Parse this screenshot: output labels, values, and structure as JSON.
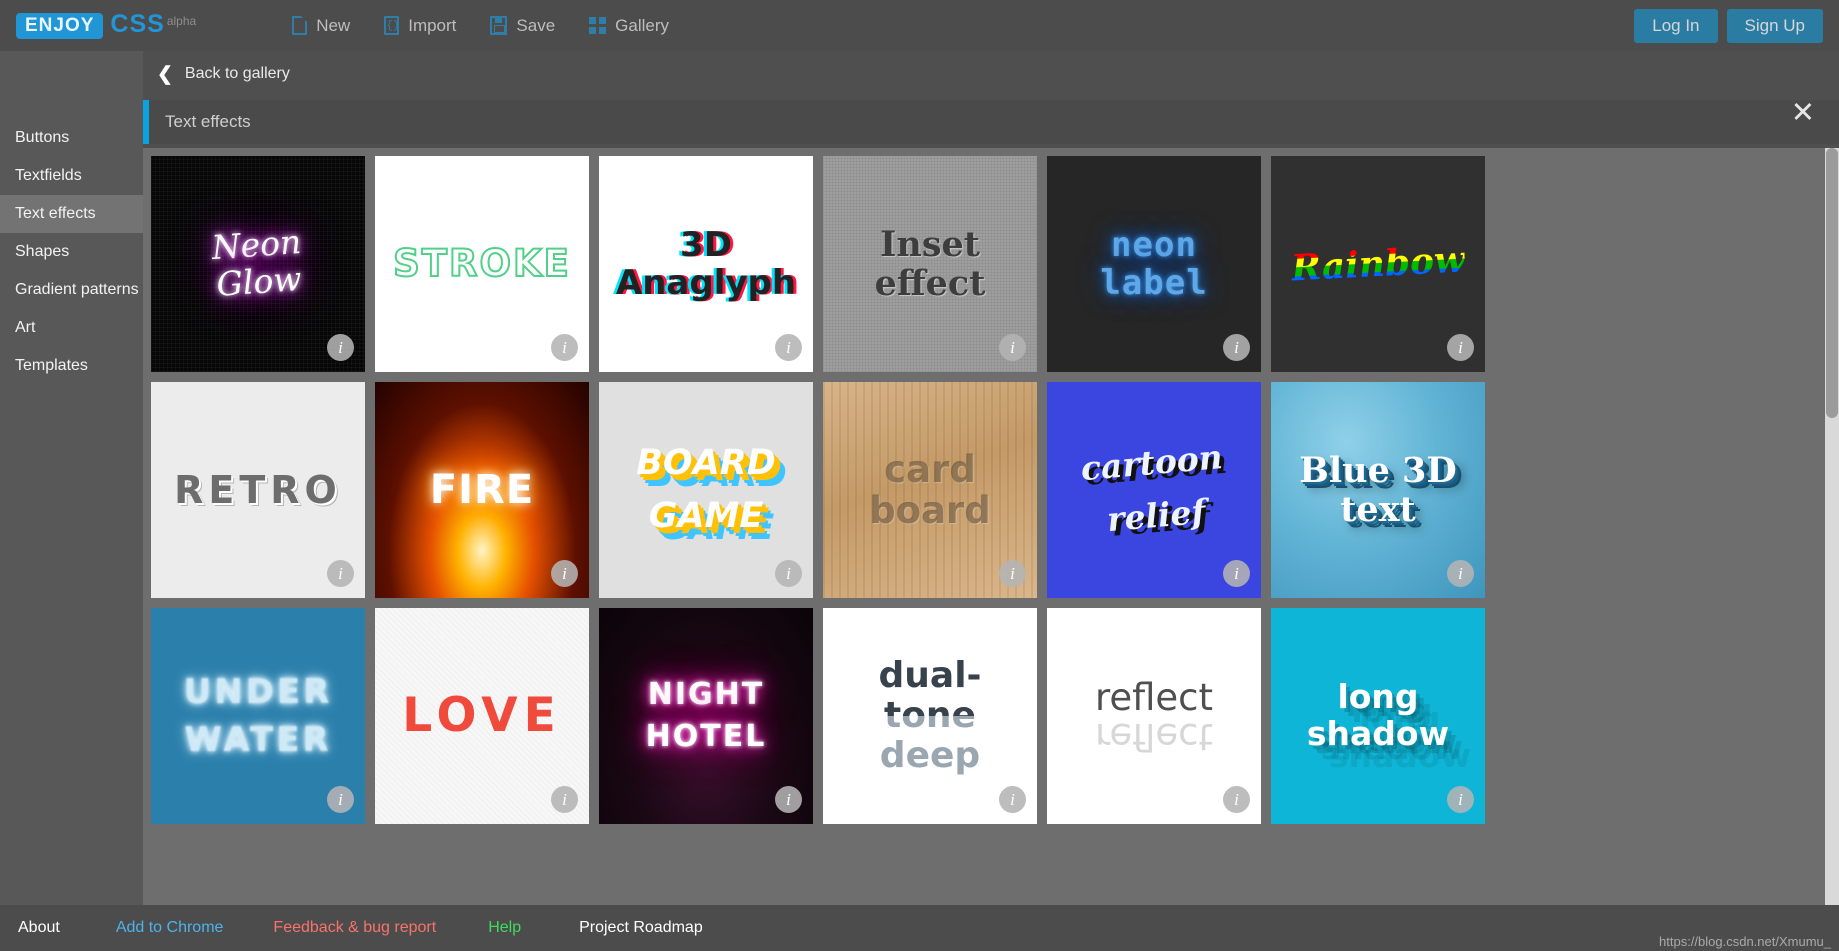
{
  "header": {
    "logo_badge": "ENJOY",
    "logo_word": "CSS",
    "logo_sup": "alpha",
    "menu": [
      {
        "label": "New",
        "icon": "new-document-icon"
      },
      {
        "label": "Import",
        "icon": "import-code-icon"
      },
      {
        "label": "Save",
        "icon": "save-floppy-icon"
      },
      {
        "label": "Gallery",
        "icon": "gallery-grid-icon"
      }
    ],
    "login_label": "Log In",
    "signup_label": "Sign Up"
  },
  "sidebar": {
    "items": [
      {
        "label": "Buttons",
        "active": false
      },
      {
        "label": "Textfields",
        "active": false
      },
      {
        "label": "Text effects",
        "active": true
      },
      {
        "label": "Shapes",
        "active": false
      },
      {
        "label": "Gradient patterns",
        "active": false
      },
      {
        "label": "Art",
        "active": false
      },
      {
        "label": "Templates",
        "active": false
      }
    ]
  },
  "panel": {
    "back_label": "Back to gallery",
    "back_icon": "chevron-left-icon",
    "close_icon": "close-icon",
    "close_glyph": "✕",
    "section_title": "Text effects",
    "accent_color": "#0aa3e0",
    "info_glyph": "i"
  },
  "cards": [
    {
      "id": "neon-glow",
      "title": "Neon Glow",
      "lines": [
        "Neon",
        "Glow"
      ],
      "style": "c-neon"
    },
    {
      "id": "stroke",
      "title": "Stroke",
      "lines": [
        "STROKE"
      ],
      "style": "c-stroke"
    },
    {
      "id": "3d-anaglyph",
      "title": "3D Anaglyph",
      "lines": [
        "3D",
        "Anaglyph"
      ],
      "style": "c-3d"
    },
    {
      "id": "inset",
      "title": "Inset effect",
      "lines": [
        "Inset",
        "effect"
      ],
      "style": "c-inset"
    },
    {
      "id": "neon-label",
      "title": "neon label",
      "lines": [
        "neon",
        "label"
      ],
      "style": "c-neonlabel"
    },
    {
      "id": "rainbow",
      "title": "Rainbow",
      "lines": [
        "Rainbow"
      ],
      "style": "c-rainbow"
    },
    {
      "id": "retro",
      "title": "RETRO",
      "lines": [
        "RETRO"
      ],
      "style": "c-retro"
    },
    {
      "id": "fire",
      "title": "FIRE",
      "lines": [
        "FIRE"
      ],
      "style": "c-fire"
    },
    {
      "id": "board-game",
      "title": "BOARD GAME",
      "lines": [
        "BOARD",
        "GAME"
      ],
      "style": "c-board"
    },
    {
      "id": "card-board",
      "title": "card board",
      "lines": [
        "card",
        "board"
      ],
      "style": "c-card"
    },
    {
      "id": "cartoon-relief",
      "title": "cartoon relief",
      "lines": [
        "cartoon",
        "relief"
      ],
      "style": "c-cartoon"
    },
    {
      "id": "blue-3d-text",
      "title": "Blue 3D text",
      "lines": [
        "Blue 3D",
        "text"
      ],
      "style": "c-blue3d"
    },
    {
      "id": "under-water",
      "title": "UNDER WATER",
      "lines": [
        "UNDER",
        "WATER"
      ],
      "style": "c-under"
    },
    {
      "id": "love",
      "title": "LOVE",
      "lines": [
        "LOVE"
      ],
      "style": "c-love"
    },
    {
      "id": "night-hotel",
      "title": "NIGHT HOTEL",
      "lines": [
        "NIGHT",
        "HOTEL"
      ],
      "style": "c-night"
    },
    {
      "id": "dual-tone-deep",
      "title": "dual-tone deep",
      "lines": [
        "dual-",
        "tone",
        "deep"
      ],
      "style": "c-dual"
    },
    {
      "id": "reflect",
      "title": "reflect",
      "lines": [
        "reflect"
      ],
      "style": "c-reflect"
    },
    {
      "id": "long-shadow",
      "title": "long shadow",
      "lines": [
        "long",
        "shadow"
      ],
      "style": "c-long"
    }
  ],
  "footer": {
    "links": [
      {
        "label": "About",
        "color": "#ffffff"
      },
      {
        "label": "Add to Chrome",
        "color": "#4db2ec"
      },
      {
        "label": "Feedback & bug report",
        "color": "#f8736a"
      },
      {
        "label": "Help",
        "color": "#3ddc5c"
      },
      {
        "label": "Project Roadmap",
        "color": "#ffffff"
      }
    ],
    "watermark": "https://blog.csdn.net/Xmumu_"
  }
}
